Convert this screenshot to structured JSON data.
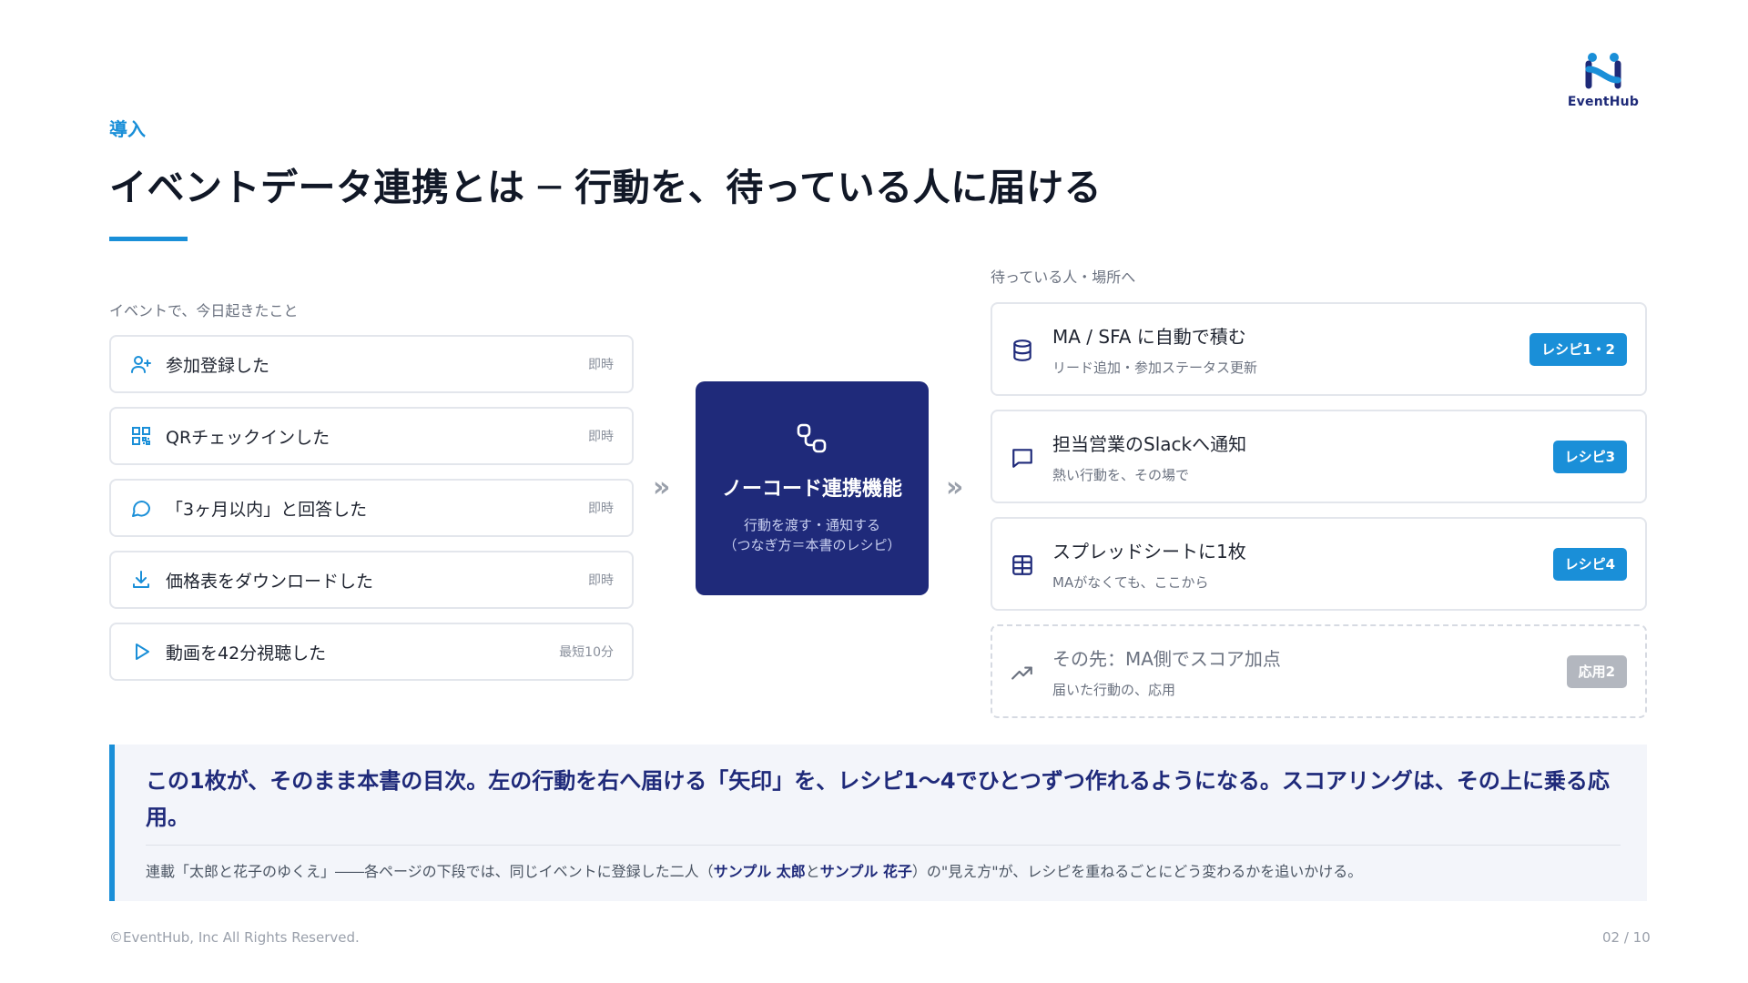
{
  "header": {
    "brand_name": "EventHub",
    "section_label": "導入",
    "title": "イベントデータ連携とは ─ 行動を、待っている人に届ける"
  },
  "left_column": {
    "label": "イベントで、今日起きたこと",
    "events": [
      {
        "icon": "user-plus-icon",
        "text": "参加登録した",
        "timing": "即時"
      },
      {
        "icon": "qr-code-icon",
        "text": "QRチェックインした",
        "timing": "即時"
      },
      {
        "icon": "chat-bubble-icon",
        "text": "「3ヶ月以内」と回答した",
        "timing": "即時"
      },
      {
        "icon": "download-icon",
        "text": "価格表をダウンロードした",
        "timing": "即時"
      },
      {
        "icon": "play-icon",
        "text": "動画を42分視聴した",
        "timing": "最短10分"
      }
    ]
  },
  "center": {
    "icon": "link-icon",
    "title": "ノーコード連携機能",
    "subtitle_line1": "行動を渡す・通知する",
    "subtitle_line2": "（つなぎ方＝本書のレシピ）",
    "arrow_glyph": "»"
  },
  "right_column": {
    "label": "待っている人・場所へ",
    "destinations": [
      {
        "icon": "database-icon",
        "title": "MA / SFA に自動で積む",
        "subtitle": "リード追加・参加ステータス更新",
        "tag": "レシピ1・2"
      },
      {
        "icon": "message-square-icon",
        "title": "担当営業のSlackへ通知",
        "subtitle": "熱い行動を、その場で",
        "tag": "レシピ3"
      },
      {
        "icon": "table-icon",
        "title": "スプレッドシートに1枚",
        "subtitle": "MAがなくても、ここから",
        "tag": "レシピ4"
      },
      {
        "icon": "trending-up-icon",
        "title": "その先：MA側でスコア加点",
        "subtitle": "届いた行動の、応用",
        "tag": "応用2"
      }
    ]
  },
  "callout": {
    "main": "この1枚が、そのまま本書の目次。左の行動を右へ届ける「矢印」を、レシピ1〜4でひとつずつ作れるようになる。スコアリングは、その上に乗る応用。",
    "note_prefix": "連載「太郎と花子のゆくえ」――各ページの下段では、同じイベントに登録した二人（",
    "note_name1": "サンプル 太郎",
    "note_and": "と",
    "note_name2": "サンプル 花子",
    "note_suffix": "）の\"見え方\"が、レシピを重ねるごとにどう変わるかを追いかける。"
  },
  "footer": {
    "copyright": "©EventHub, Inc All Rights Reserved.",
    "page": "02 / 10"
  },
  "colors": {
    "accent_blue": "#1a8fd8",
    "navy": "#1f2a7a",
    "muted_tag": "#b3b7bf"
  }
}
